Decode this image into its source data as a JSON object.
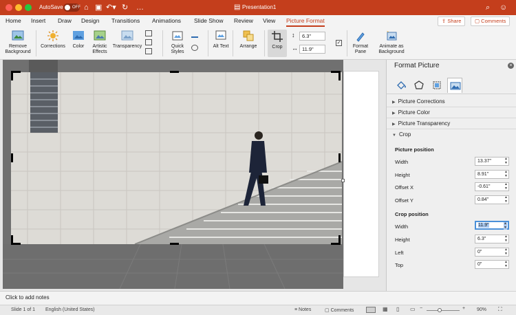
{
  "titlebar": {
    "autosave_label": "AutoSave",
    "autosave_state": "OFF",
    "doc_title": "Presentation1",
    "search_placeholder": "",
    "colors": {
      "bg": "#c43e1c"
    }
  },
  "tabs": [
    "Home",
    "Insert",
    "Draw",
    "Design",
    "Transitions",
    "Animations",
    "Slide Show",
    "Review",
    "View",
    "Picture Format"
  ],
  "active_tab": "Picture Format",
  "header_buttons": {
    "share": "Share",
    "comments": "Comments"
  },
  "ribbon": {
    "remove_background": "Remove Background",
    "corrections": "Corrections",
    "color": "Color",
    "artistic_effects": "Artistic Effects",
    "transparency": "Transparency",
    "quick_styles": "Quick Styles",
    "alt_text": "Alt Text",
    "arrange": "Arrange",
    "crop": "Crop",
    "height_value": "6.3\"",
    "width_value": "11.9\"",
    "format_pane": "Format Pane",
    "animate_as_background": "Animate as Background"
  },
  "notes": {
    "placeholder": "Click to add notes"
  },
  "status": {
    "slide": "Slide 1 of 1",
    "language": "English (United States)",
    "notes": "Notes",
    "comments": "Comments",
    "zoom": "90%"
  },
  "pane": {
    "title": "Format Picture",
    "sections": {
      "corrections": "Picture Corrections",
      "color": "Picture Color",
      "transparency": "Picture Transparency",
      "crop": "Crop"
    },
    "picture_position": {
      "heading": "Picture position",
      "width_label": "Width",
      "width": "13.37\"",
      "height_label": "Height",
      "height": "8.91\"",
      "offset_x_label": "Offset X",
      "offset_x": "-0.61\"",
      "offset_y_label": "Offset Y",
      "offset_y": "0.84\""
    },
    "crop_position": {
      "heading": "Crop position",
      "width_label": "Width",
      "width": "11.9\"",
      "height_label": "Height",
      "height": "6.3\"",
      "left_label": "Left",
      "left": "0\"",
      "top_label": "Top",
      "top": "0\""
    }
  }
}
